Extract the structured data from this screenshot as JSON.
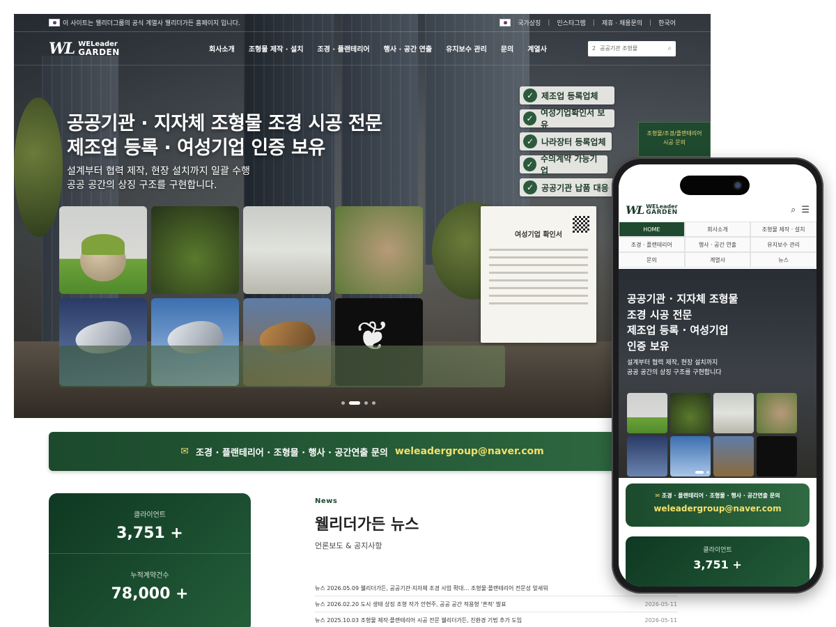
{
  "desktop": {
    "topbar": {
      "notice": "이 사이트는 웰리더그룹의 공식 계열사 웰리더가든 홈페이지 입니다.",
      "links": [
        "국가상징",
        "인스타그램",
        "제휴 · 채용문의",
        "한국어"
      ]
    },
    "logo": {
      "mark": "WL",
      "line1": "WELeader",
      "line2": "GARDEN"
    },
    "menu": [
      "회사소개",
      "조형물 제작 · 설치",
      "조경 · 플랜테리어",
      "행사 · 공간 연출",
      "유지보수 관리",
      "문의",
      "계열사"
    ],
    "search": {
      "value": "2",
      "placeholder": "공공기관 조형물"
    },
    "hero": {
      "title_line1": "공공기관 · 지자체 조형물 조경 시공 전문",
      "title_line2": "제조업 등록 · 여성기업 인증 보유",
      "sub_line1": "설계부터 협력 제작, 현장 설치까지 일괄 수행",
      "sub_line2": "공공 공간의 상징 구조를 구현합니다."
    },
    "badges": [
      "제조업 등록업체",
      "여성기업확인서 보유",
      "나라장터 등록업체",
      "수의계약 가능기업",
      "공공기관 납품 대응"
    ],
    "side_cta": {
      "line1": "조형물/조경/플랜테리어",
      "line2": "시공 문의"
    },
    "certificate": {
      "title": "여성기업 확인서"
    },
    "contact": {
      "label": "조경 · 플랜테리어 · 조형물 · 행사 · 공간연출 문의",
      "email": "weleadergroup@naver.com"
    },
    "stats": [
      {
        "label": "클라이언트",
        "value": "3,751 +"
      },
      {
        "label": "누적계약건수",
        "value": "78,000 +"
      }
    ],
    "news": {
      "eyebrow": "News",
      "title": "웰리더가든 뉴스",
      "subtitle": "언론보도 & 공지사항",
      "items": [
        {
          "text": "뉴스 2026.05.09 웰리더가든, 공공기관·지자체 조경 사업 확대… 조형물·플랜테리어 전문성 앞세워",
          "date": ""
        },
        {
          "text": "뉴스 2026.02.20 도시 생태 상징 조형 작가 안현주, 공공 공간 적용형 '흔적' 발표",
          "date": "2026-05-11"
        },
        {
          "text": "뉴스 2025.10.03 조형물 제작·플랜테리어 시공 전문 웰리더가든, 친환경 기법 추가 도입",
          "date": "2026-05-11"
        }
      ]
    }
  },
  "phone": {
    "logo": {
      "mark": "WL",
      "line1": "WELeader",
      "line2": "GARDEN"
    },
    "nav": [
      "HOME",
      "회사소개",
      "조형물 제작 · 설치",
      "조경 · 플랜테리어",
      "행사 · 공간 연출",
      "유지보수 관리",
      "문의",
      "계열사",
      "뉴스"
    ],
    "hero": {
      "title_line1": "공공기관 · 지자체 조형물",
      "title_line2": "조경 시공 전문",
      "title_line3": "제조업 등록 · 여성기업",
      "title_line4": "인증 보유",
      "sub_line1": "설계부터 협력 제작, 현장 설치까지",
      "sub_line2": "공공 공간의 상징 구조를 구현합니다"
    },
    "contact": {
      "label": "조경 · 플랜테리어 · 조형물 · 행사 · 공간연출 문의",
      "email": "weleadergroup@naver.com"
    },
    "stat": {
      "label": "클라이언트",
      "value": "3,751 +"
    }
  },
  "colors": {
    "brand_green": "#1f4a2f",
    "accent_yellow": "#f2e06b"
  }
}
